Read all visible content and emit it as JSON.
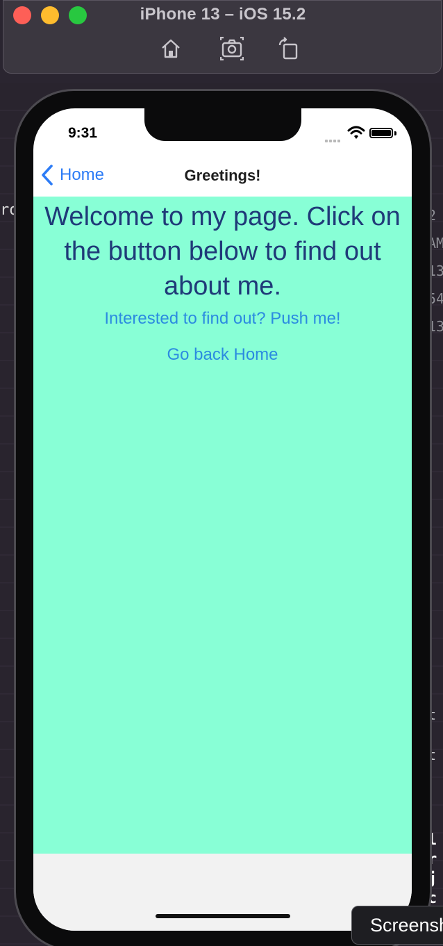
{
  "simulator": {
    "title": "iPhone 13 – iOS 15.2",
    "tools": [
      "home-icon",
      "screenshot-icon",
      "rotate-icon"
    ]
  },
  "status_bar": {
    "time": "9:31"
  },
  "nav": {
    "back_label": "Home",
    "title": "Greetings!"
  },
  "content": {
    "headline": "Welcome to my page. Click on the button below to find out about me.",
    "interested_button": "Interested to find out? Push me!",
    "go_back_button": "Go back Home"
  },
  "background": {
    "left_edge_text": "ro",
    "right_edge_lines": [
      "2",
      "AM",
      "13",
      "54",
      "13"
    ],
    "right_low_lines": [
      "t",
      "t"
    ],
    "code_lines": [
      "l",
      "r",
      "j",
      "c"
    ]
  },
  "overlay": {
    "screenshot_label": "Screenshot"
  },
  "colors": {
    "content_background": "#88ffd6",
    "headline": "#1f3a78",
    "link": "#2b8be0",
    "nav_back": "#2d7cf6"
  }
}
